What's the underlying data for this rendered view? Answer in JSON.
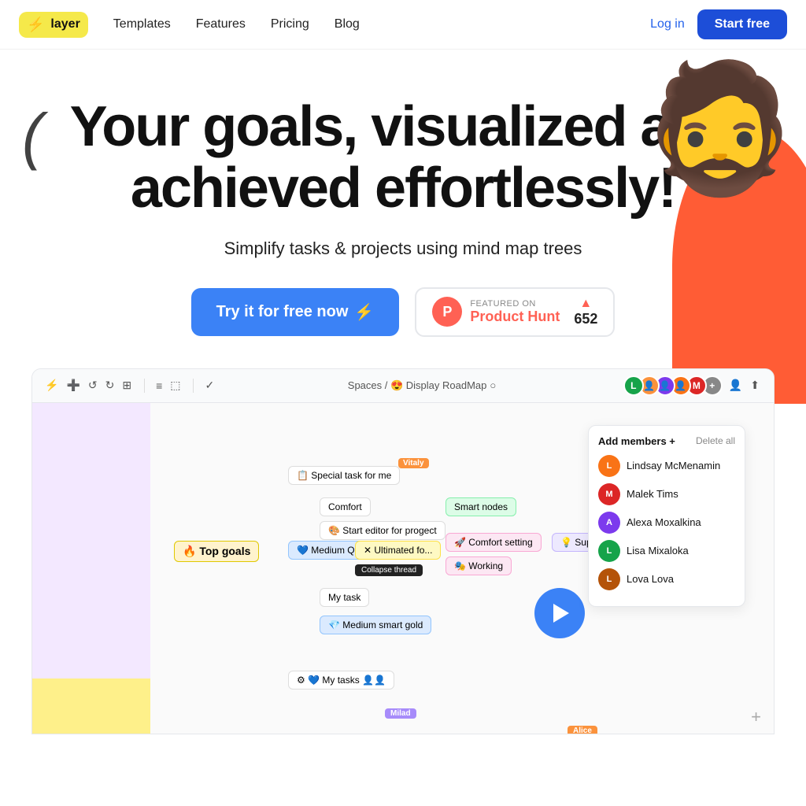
{
  "nav": {
    "logo_text": "layer",
    "links": [
      "Templates",
      "Features",
      "Pricing",
      "Blog"
    ],
    "login_label": "Log in",
    "start_label": "Start free"
  },
  "hero": {
    "headline_1": "Your goals, visualized and",
    "headline_2": "achieved effortlessly!",
    "subheadline": "Simplify tasks & projects using mind map trees",
    "cta_primary": "Try it for free now",
    "cta_ph_featured": "FEATURED ON",
    "cta_ph_name": "Product Hunt",
    "cta_ph_votes": "652"
  },
  "app": {
    "breadcrumb": "Spaces / 😍 Display RoadMap",
    "members": [
      {
        "name": "Lindsay McMenamin",
        "color": "#f97316",
        "initial": "L"
      },
      {
        "name": "Malek Tims",
        "color": "#dc2626",
        "initial": "M"
      },
      {
        "name": "Alexa Moxalkina",
        "color": "#7c3aed",
        "initial": "A"
      },
      {
        "name": "Lisa Mixaloka",
        "color": "#16a34a",
        "initial": "L"
      },
      {
        "name": "Lova Lova",
        "color": "#b45309",
        "initial": "L"
      }
    ],
    "add_members_label": "Add members +",
    "delete_all_label": "Delete all",
    "mindmap_root": "🔥 Top goals",
    "nodes": [
      "Special task for me",
      "Comfort",
      "Start editor for progect",
      "Smart nodes",
      "Ultimated fo...",
      "Comfort setting",
      "Super",
      "Working",
      "My task",
      "Medium smart gold",
      "Medium Q",
      "My tasks"
    ]
  }
}
